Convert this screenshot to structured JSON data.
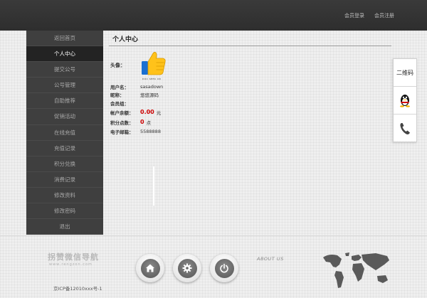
{
  "header": {
    "links": [
      {
        "label": "会员登录"
      },
      {
        "label": "会员注册"
      }
    ]
  },
  "sidebar": {
    "items": [
      {
        "label": "返回首页",
        "active": false
      },
      {
        "label": "个人中心",
        "active": true
      },
      {
        "label": "提交公号",
        "active": false
      },
      {
        "label": "公号管理",
        "active": false
      },
      {
        "label": "自助推荐",
        "active": false
      },
      {
        "label": "促销活动",
        "active": false
      },
      {
        "label": "在线充值",
        "active": false
      },
      {
        "label": "充值记录",
        "active": false
      },
      {
        "label": "积分兑换",
        "active": false
      },
      {
        "label": "消费记录",
        "active": false
      },
      {
        "label": "修改资料",
        "active": false
      },
      {
        "label": "修改密码",
        "active": false
      },
      {
        "label": "退出",
        "active": false
      }
    ]
  },
  "profile": {
    "title": "个人中心",
    "avatar_label": "头像：",
    "avatar_caption": "DOC SEEK CN",
    "fields": {
      "username": {
        "label": "用户名：",
        "value": "sasadown"
      },
      "nickname": {
        "label": "昵称：",
        "value": "悠悠源码"
      },
      "group": {
        "label": "会员组：",
        "value": ""
      },
      "balance": {
        "label": "帐户余额：",
        "value": "0.00",
        "unit": "元"
      },
      "points": {
        "label": "积分点数：",
        "value": "0",
        "unit": "点"
      },
      "email": {
        "label": "电子邮箱：",
        "value": "5588888"
      }
    }
  },
  "float_bar": {
    "qr_label": "二维码",
    "qq_icon": "qq-penguin-icon",
    "phone_icon": "phone-icon"
  },
  "footer": {
    "logo_main": "拐赞微信导航",
    "logo_sub": "www.rengzon.com",
    "icp": "京ICP备12010xxx号-1",
    "about": "ABOUT US",
    "buttons": [
      {
        "icon": "home-icon"
      },
      {
        "icon": "gear-icon"
      },
      {
        "icon": "power-icon"
      }
    ]
  },
  "colors": {
    "topbar": "#333333",
    "sidebar": "#3f3f3f",
    "sidebar_active": "#232323",
    "amount": "#cc0000"
  }
}
